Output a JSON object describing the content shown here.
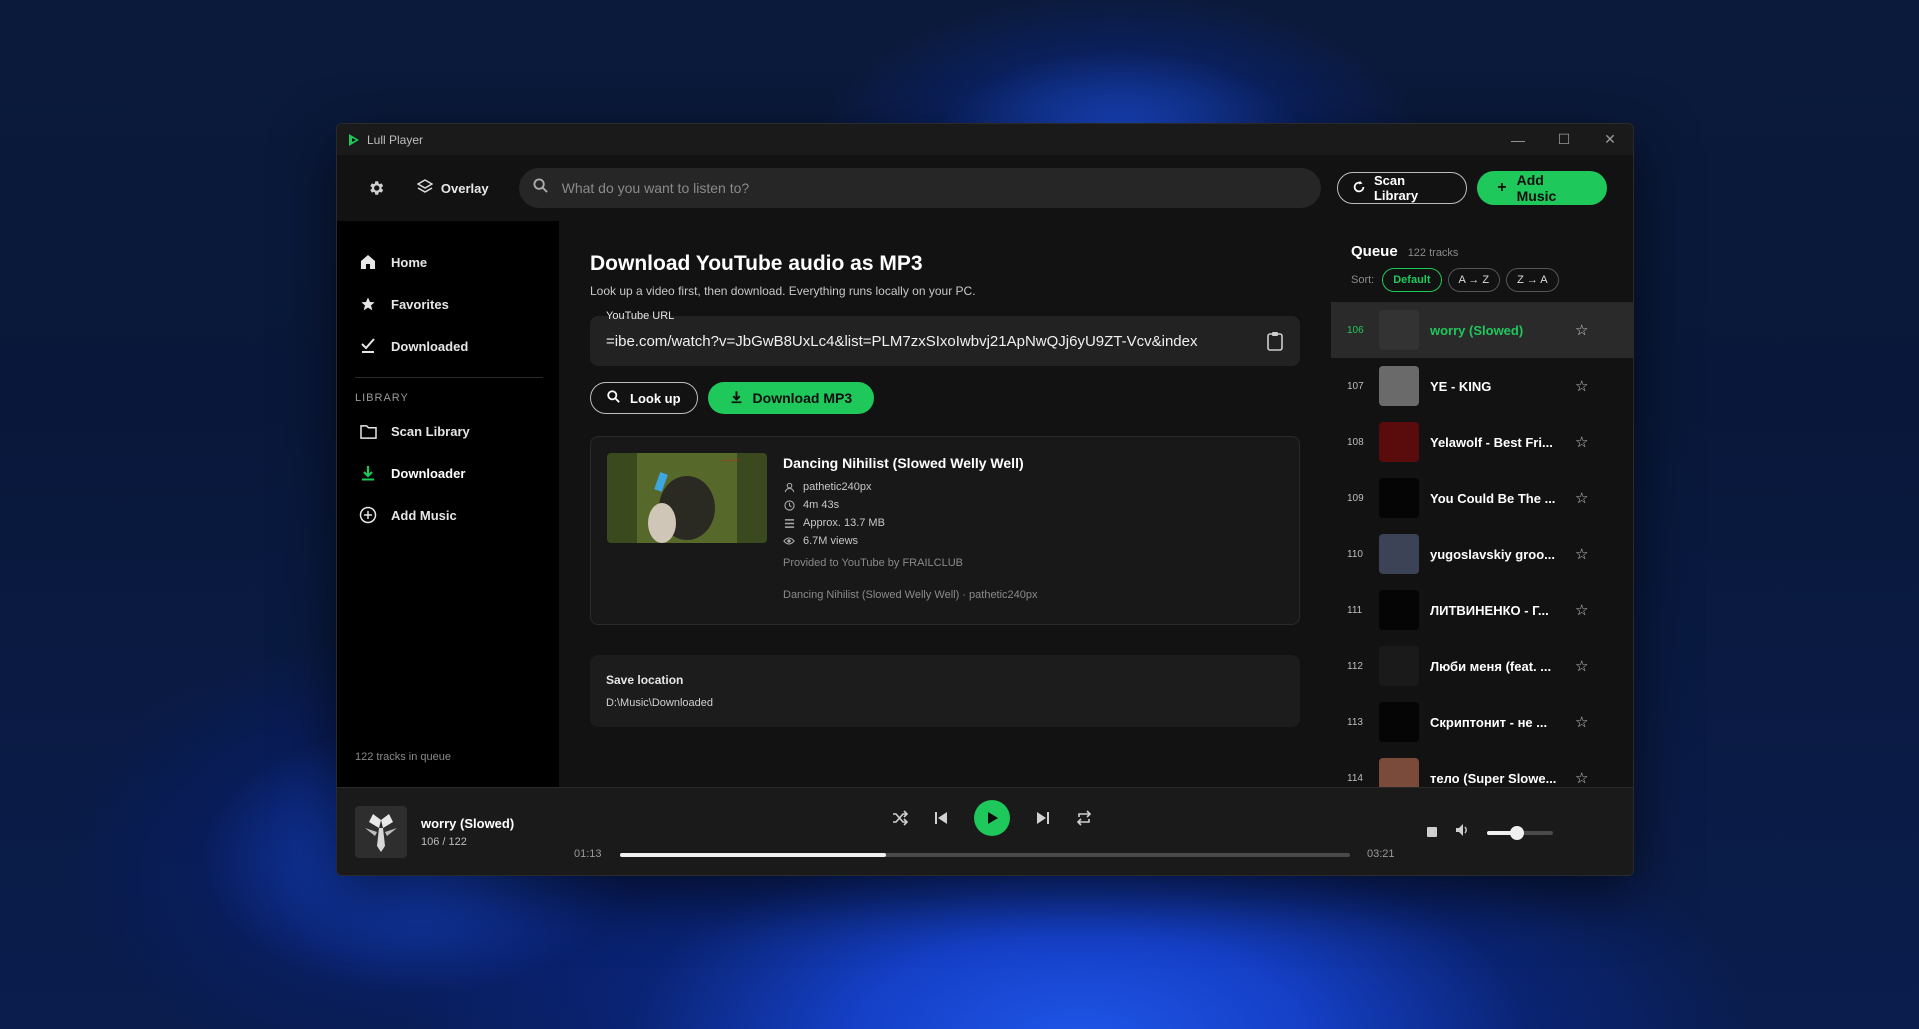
{
  "window": {
    "title": "Lull Player",
    "controls": [
      "—",
      "☐",
      "✕"
    ]
  },
  "topbar": {
    "overlay_label": "Overlay",
    "search_placeholder": "What do you want to listen to?",
    "scan_library_label": "Scan Library",
    "add_music_label": "Add Music"
  },
  "sidebar": {
    "nav": [
      {
        "label": "Home",
        "icon": "home-icon"
      },
      {
        "label": "Favorites",
        "icon": "star-icon"
      },
      {
        "label": "Downloaded",
        "icon": "check-icon"
      }
    ],
    "library_label": "LIBRARY",
    "library": [
      {
        "label": "Scan Library",
        "icon": "folder-icon"
      },
      {
        "label": "Downloader",
        "icon": "download-icon",
        "active": true
      },
      {
        "label": "Add Music",
        "icon": "plus-circle-icon"
      }
    ],
    "footer": "122 tracks in queue"
  },
  "main": {
    "title": "Download YouTube audio as MP3",
    "subtitle": "Look up a video first, then download. Everything runs locally on your PC.",
    "url_label": "YouTube URL",
    "url_value": "ibe.com/watch?v=JbGwB8UxLc4&list=PLM7zxSIxoIwbvj21ApNwQJj6yU9ZT-Vcv&index=",
    "lookup_label": "Look up",
    "download_label": "Download MP3",
    "video": {
      "title": "Dancing Nihilist (Slowed Welly Well)",
      "channel": "pathetic240px",
      "duration": "4m 43s",
      "size": "Approx. 13.7 MB",
      "views": "6.7M views",
      "provided": "Provided to YouTube by FRAILCLUB",
      "credit": "Dancing Nihilist (Slowed Welly Well) · pathetic240px"
    },
    "save_title": "Save location",
    "save_path": "D:\\Music\\Downloaded"
  },
  "queue": {
    "title": "Queue",
    "count": "122 tracks",
    "sort_label": "Sort:",
    "sort_options": [
      "Default",
      "A → Z",
      "Z → A"
    ],
    "tracks": [
      {
        "num": "106",
        "name": "worry (Slowed)",
        "current": true,
        "art": "#333333"
      },
      {
        "num": "107",
        "name": "YE - KING",
        "art": "#6a6a6a"
      },
      {
        "num": "108",
        "name": "Yelawolf - Best Fri...",
        "art": "#5a0b0b"
      },
      {
        "num": "109",
        "name": "You Could Be The ...",
        "art": "#050505"
      },
      {
        "num": "110",
        "name": "yugoslavskiy groo...",
        "art": "#3c4356"
      },
      {
        "num": "111",
        "name": "ЛИТВИНЕНКО - Г...",
        "art": "#050505"
      },
      {
        "num": "112",
        "name": "Люби меня (feat. ...",
        "art": "#1a1a1a"
      },
      {
        "num": "113",
        "name": "Скриптонит - не ...",
        "art": "#050505"
      },
      {
        "num": "114",
        "name": "тело (Super Slowe...",
        "art": "#7a4a3a"
      }
    ]
  },
  "player": {
    "title": "worry (Slowed)",
    "position": "106 / 122",
    "elapsed": "01:13",
    "total": "03:21",
    "progress": 0.365,
    "volume": 0.45
  },
  "colors": {
    "accent": "#1ec85b"
  }
}
